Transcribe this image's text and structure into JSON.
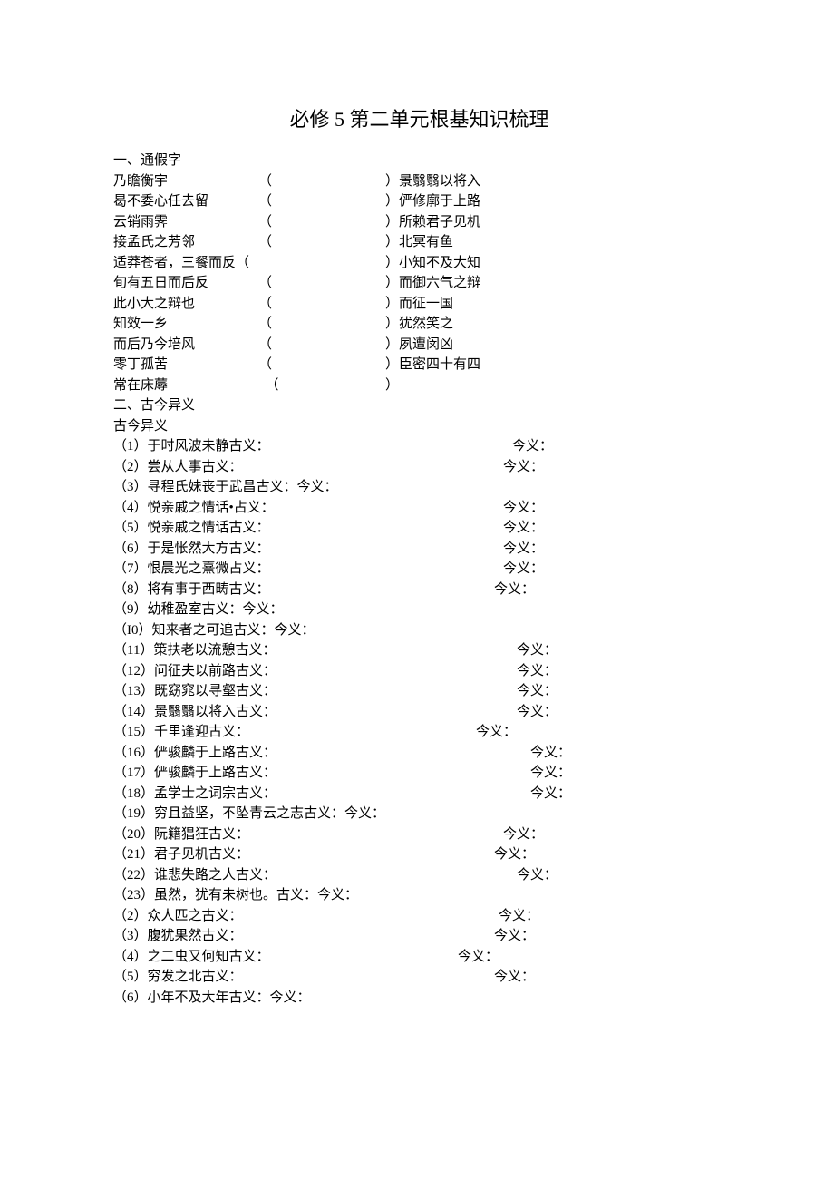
{
  "title": "必修 5 第二单元根基知识梳理",
  "sec1_head": "一、通假字",
  "s1": [
    {
      "a": "乃瞻衡宇",
      "b": "（",
      "c": "）景翳翳以将入"
    },
    {
      "a": "曷不委心任去留",
      "b": "（",
      "c": "）俨修廓于上路"
    },
    {
      "a": "云销雨霁",
      "b": "（",
      "c": "）所赖君子见机"
    },
    {
      "a": "接孟氏之芳邻",
      "b": "（",
      "c": "）北冥有鱼"
    },
    {
      "a": "适莽苍者，三餐而反（",
      "b": "",
      "c": "）小知不及大知"
    },
    {
      "a": "旬有五日而后反",
      "b": "（",
      "c": "）而御六气之辩"
    },
    {
      "a": "此小大之辩也",
      "b": "（",
      "c": "）而征一国"
    },
    {
      "a": "知效一乡",
      "b": "（",
      "c": "）犹然笑之"
    },
    {
      "a": "而后乃今培风",
      "b": "（",
      "c": "）夙遭闵凶"
    },
    {
      "a": "零丁孤苦",
      "b": "（",
      "c": "）臣密四十有四"
    },
    {
      "a": "常在床蓐",
      "b": "  （",
      "c": "）"
    }
  ],
  "sec2_head1": "二、古今异义",
  "sec2_head2": "古今异义",
  "s2": [
    {
      "l": "（1）于时风波未静古义：",
      "r": "今义："
    },
    {
      "l": "（2）尝从人事古义：",
      "r": "今义："
    },
    {
      "l": "（3）寻程氏妹丧于武昌古义：今义：",
      "r": ""
    },
    {
      "l": "（4）悦亲戚之情话•占义：",
      "r": "今义："
    },
    {
      "l": "（5）悦亲戚之情话古义：",
      "r": "今义："
    },
    {
      "l": "（6）于是怅然大方古义：",
      "r": "今义："
    },
    {
      "l": "（7）恨晨光之熹微占义：",
      "r": "今义："
    },
    {
      "l": "（8）将有事于西畴古义：",
      "r": "今义："
    },
    {
      "l": "（9）幼稚盈室古义：今义：",
      "r": ""
    },
    {
      "l": "（I0）知来者之可追古义：今义：",
      "r": ""
    },
    {
      "l": "（11）策扶老以流憩古义：",
      "r": "今义："
    },
    {
      "l": "（12）问征夫以前路古义：",
      "r": "今义："
    },
    {
      "l": "（13）既窈窕以寻壑古义：",
      "r": "今义："
    },
    {
      "l": "（14）景翳翳以将入古义：",
      "r": "今义："
    },
    {
      "l": "（15）千里逢迎古义：",
      "r": "今义："
    },
    {
      "l": "（16）俨骏麟于上路古义：",
      "r": "今义："
    },
    {
      "l": "（17）俨骏麟于上路古义：",
      "r": "今义："
    },
    {
      "l": "（18）孟学士之词宗古义：",
      "r": "今义："
    },
    {
      "l": "（19）穷且益坚，不坠青云之志古义：今义：",
      "r": ""
    },
    {
      "l": "（20）阮籍猖狂古义：",
      "r": "今义："
    },
    {
      "l": "（21）君子见机古义：",
      "r": "今义："
    },
    {
      "l": "（22）谁悲失路之人古义：",
      "r": "今义："
    },
    {
      "l": "（23）虽然，犹有未树也。古义：今义：",
      "r": ""
    },
    {
      "l": "（2）众人匹之古义：",
      "r": "今义："
    },
    {
      "l": "（3）腹犹果然古义：",
      "r": "今义："
    },
    {
      "l": "（4）之二虫又何知古义：",
      "r": "今义："
    },
    {
      "l": "（5）穷发之北古义：",
      "r": "今义："
    },
    {
      "l": "（6）小年不及大年古义：今义：",
      "r": ""
    }
  ],
  "rw": [
    440,
    430,
    355,
    430,
    430,
    430,
    430,
    420,
    0,
    0,
    445,
    445,
    445,
    445,
    400,
    460,
    460,
    460,
    0,
    430,
    420,
    445,
    0,
    425,
    420,
    380,
    420,
    0
  ]
}
